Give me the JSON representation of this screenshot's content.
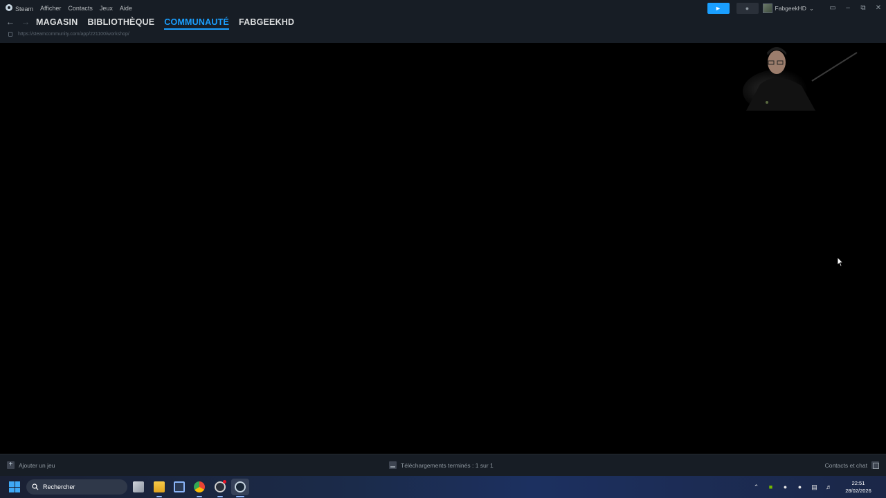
{
  "menu": {
    "app": "Steam",
    "items": [
      "Afficher",
      "Contacts",
      "Jeux",
      "Aide"
    ]
  },
  "nav": {
    "tabs": [
      {
        "label": "MAGASIN",
        "active": false
      },
      {
        "label": "BIBLIOTHÈQUE",
        "active": false
      },
      {
        "label": "COMMUNAUTÉ",
        "active": true
      },
      {
        "label": "FABGEEKHD",
        "active": false
      }
    ],
    "url": "https://steamcommunity.com/app/221100/workshop/"
  },
  "user": {
    "name": "FabgeekHD"
  },
  "statusbar": {
    "add_game": "Ajouter un jeu",
    "downloads": "Téléchargements terminés : 1 sur 1",
    "friends": "Contacts et chat"
  },
  "taskbar": {
    "search_placeholder": "Rechercher",
    "time": "22:51",
    "date": "28/02/2026"
  },
  "colors": {
    "accent": "#1a9fff",
    "titlebar": "#171d25",
    "content": "#000000"
  }
}
